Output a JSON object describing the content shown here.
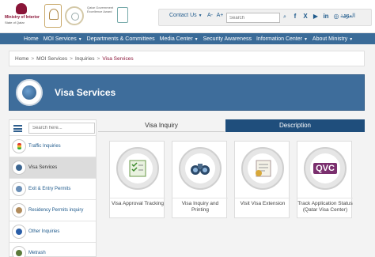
{
  "header": {
    "logos": {
      "moi_line1": "Ministry of Interior",
      "moi_line2": "State of Qatar",
      "award_line1": "Qatar Government",
      "award_line2": "Excellence Award"
    },
    "contact_label": "Contact Us",
    "font_decrease": "A-",
    "font_increase": "A+",
    "search_placeholder": "Search",
    "social_icons": [
      "facebook-icon",
      "x-icon",
      "youtube-icon",
      "linkedin-icon",
      "instagram-icon",
      "email-icon"
    ],
    "social_glyphs": [
      "f",
      "X",
      "▶",
      "in",
      "◎",
      "✉"
    ],
    "language_label": "العربية"
  },
  "nav": {
    "items": [
      {
        "label": "Home",
        "dropdown": false
      },
      {
        "label": "MOI Services",
        "dropdown": true
      },
      {
        "label": "Departments & Committees",
        "dropdown": false
      },
      {
        "label": "Media Center",
        "dropdown": true
      },
      {
        "label": "Security Awareness",
        "dropdown": false
      },
      {
        "label": "Information Center",
        "dropdown": true
      },
      {
        "label": "About Ministry",
        "dropdown": true
      }
    ]
  },
  "breadcrumb": {
    "items": [
      "Home",
      "MOI Services",
      "Inquiries",
      "Visa Services"
    ],
    "separator": ">"
  },
  "page": {
    "title": "Visa Services"
  },
  "sidebar": {
    "search_placeholder": "Search here...",
    "items": [
      {
        "label": "Traffic Inquiries",
        "icon": "traffic-light-icon",
        "active": false
      },
      {
        "label": "Visa Services",
        "icon": "globe-icon",
        "active": true
      },
      {
        "label": "Exit & Entry Permits",
        "icon": "airplane-icon",
        "active": false
      },
      {
        "label": "Residency Permits inquiry",
        "icon": "residency-card-icon",
        "active": false
      },
      {
        "label": "Other Inquiries",
        "icon": "info-icon",
        "active": false
      },
      {
        "label": "Metrash",
        "icon": "metrash-icon",
        "active": false
      }
    ]
  },
  "tabs": {
    "inquiry": "Visa Inquiry",
    "description": "Description"
  },
  "services": [
    {
      "label": "Visa Approval Tracking",
      "icon": "checklist-icon"
    },
    {
      "label": "Visa Inquiry and Printing",
      "icon": "binoculars-icon"
    },
    {
      "label": "Visit Visa Extension",
      "icon": "visa-document-icon"
    },
    {
      "label": "Track Application Status (Qatar Visa Center)",
      "icon": "qvc-logo-icon",
      "logo_text": "QVC"
    }
  ],
  "colors": {
    "brand_blue": "#3a6b98",
    "tab_active": "#1f4e7c",
    "maroon": "#8a1538"
  }
}
